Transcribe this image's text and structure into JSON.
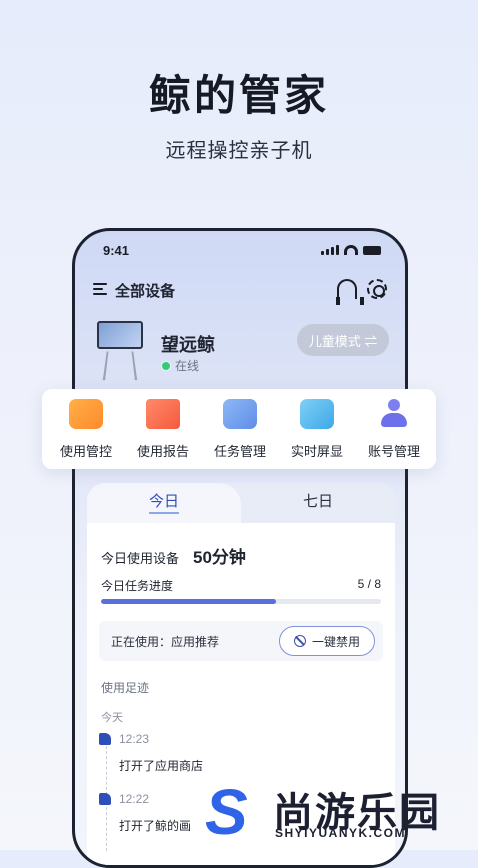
{
  "header": {
    "title": "鲸的管家",
    "subtitle": "远程操控亲子机"
  },
  "status_bar": {
    "time": "9:41"
  },
  "topbar": {
    "label": "全部设备"
  },
  "device": {
    "name": "望远鲸",
    "status": "在线",
    "mode_button": "儿童模式 ⇌"
  },
  "functions": [
    {
      "label": "使用管控",
      "icon": "control-icon"
    },
    {
      "label": "使用报告",
      "icon": "report-icon"
    },
    {
      "label": "任务管理",
      "icon": "task-icon"
    },
    {
      "label": "实时屏显",
      "icon": "screen-icon"
    },
    {
      "label": "账号管理",
      "icon": "account-icon"
    }
  ],
  "tabs": {
    "today": "今日",
    "week": "七日"
  },
  "usage": {
    "label": "今日使用设备",
    "value": "50分钟"
  },
  "tasks": {
    "label": "今日任务进度",
    "count": "5 / 8",
    "progress": 0.625
  },
  "in_use": {
    "text": "正在使用：应用推荐",
    "ban_button": "一键禁用"
  },
  "footprint": {
    "title": "使用足迹",
    "day": "今天",
    "items": [
      {
        "time": "12:23",
        "text": "打开了应用商店"
      },
      {
        "time": "12:22",
        "text": "打开了鲸的画"
      }
    ]
  },
  "watermark": {
    "cn": "尚游乐园",
    "en": "SHYIYUANYK.COM",
    "mark": "S"
  },
  "colors": {
    "accent": "#2f4fb8",
    "progress": "#5a6fd8",
    "online": "#37c97a",
    "watermark_blue": "#2f63e8"
  }
}
